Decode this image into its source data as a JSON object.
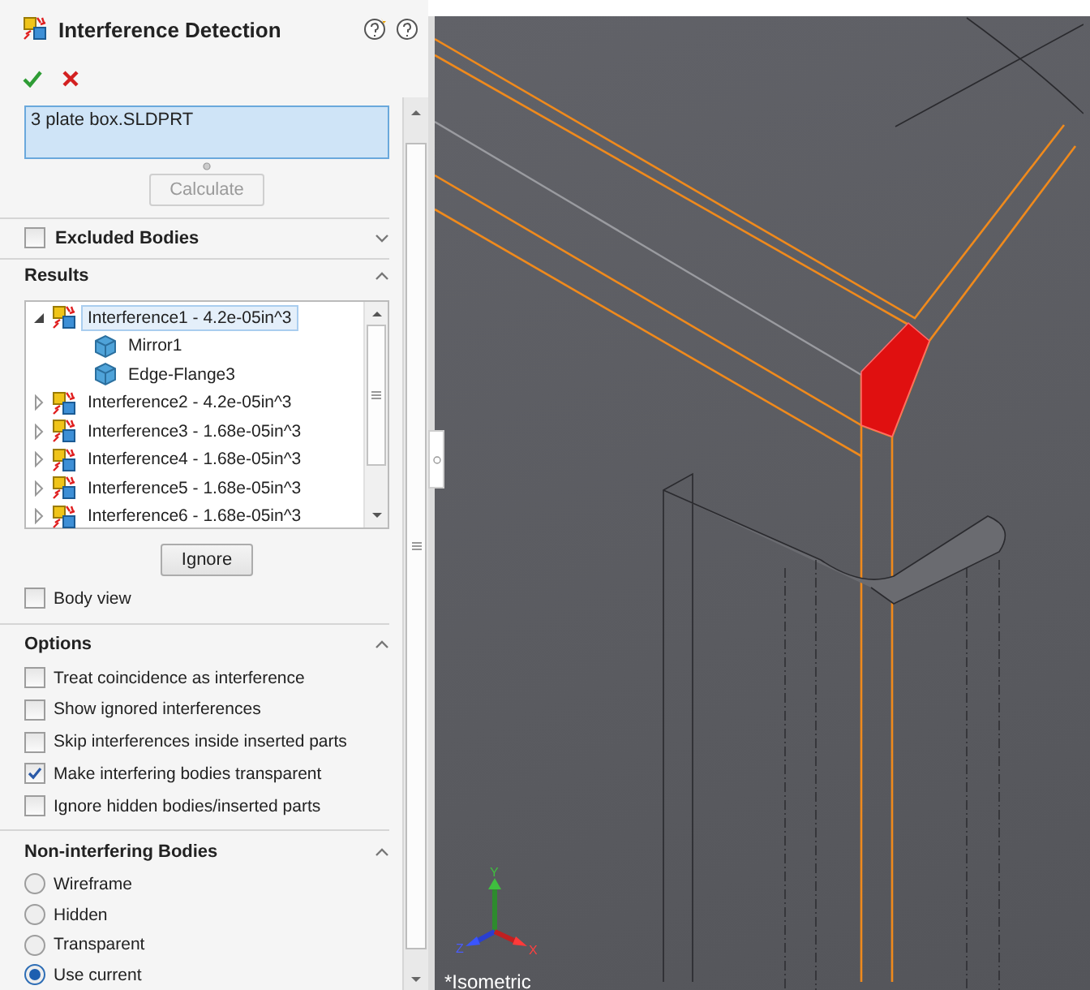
{
  "panel": {
    "title": "Interference Detection",
    "selection": {
      "value": "3 plate box.SLDPRT"
    },
    "calculate": {
      "label": "Calculate",
      "disabled": true
    },
    "excluded_bodies": {
      "label": "Excluded Bodies",
      "checked": false,
      "expanded": false
    },
    "results": {
      "label": "Results",
      "expanded": true,
      "items": [
        {
          "label": "Interference1 - 4.2e-05in^3",
          "expanded": true,
          "selected": true,
          "children": [
            {
              "label": "Mirror1",
              "selected": false
            },
            {
              "label": "Edge-Flange3",
              "selected": false
            }
          ]
        },
        {
          "label": "Interference2 - 4.2e-05in^3",
          "expanded": false,
          "selected": false
        },
        {
          "label": "Interference3 - 1.68e-05in^3",
          "expanded": false,
          "selected": false
        },
        {
          "label": "Interference4 - 1.68e-05in^3",
          "expanded": false,
          "selected": false
        },
        {
          "label": "Interference5 - 1.68e-05in^3",
          "expanded": false,
          "selected": false
        },
        {
          "label": "Interference6 - 1.68e-05in^3",
          "expanded": false,
          "selected": false
        }
      ],
      "ignore": "Ignore",
      "body_view": {
        "label": "Body view",
        "checked": false
      }
    },
    "options": {
      "label": "Options",
      "expanded": true,
      "items": [
        {
          "label": "Treat coincidence as interference",
          "checked": false
        },
        {
          "label": "Show ignored interferences",
          "checked": false
        },
        {
          "label": "Skip interferences inside inserted parts",
          "checked": false
        },
        {
          "label": "Make interfering bodies transparent",
          "checked": true
        },
        {
          "label": "Ignore hidden bodies/inserted parts",
          "checked": false
        }
      ]
    },
    "non_interfering": {
      "label": "Non-interfering Bodies",
      "expanded": true,
      "items": [
        {
          "label": "Wireframe",
          "selected": false
        },
        {
          "label": "Hidden",
          "selected": false
        },
        {
          "label": "Transparent",
          "selected": false
        },
        {
          "label": "Use current",
          "selected": true
        }
      ]
    }
  },
  "viewport": {
    "view_label": "*Isometric",
    "axes": [
      "Y",
      "Z",
      "X"
    ]
  }
}
